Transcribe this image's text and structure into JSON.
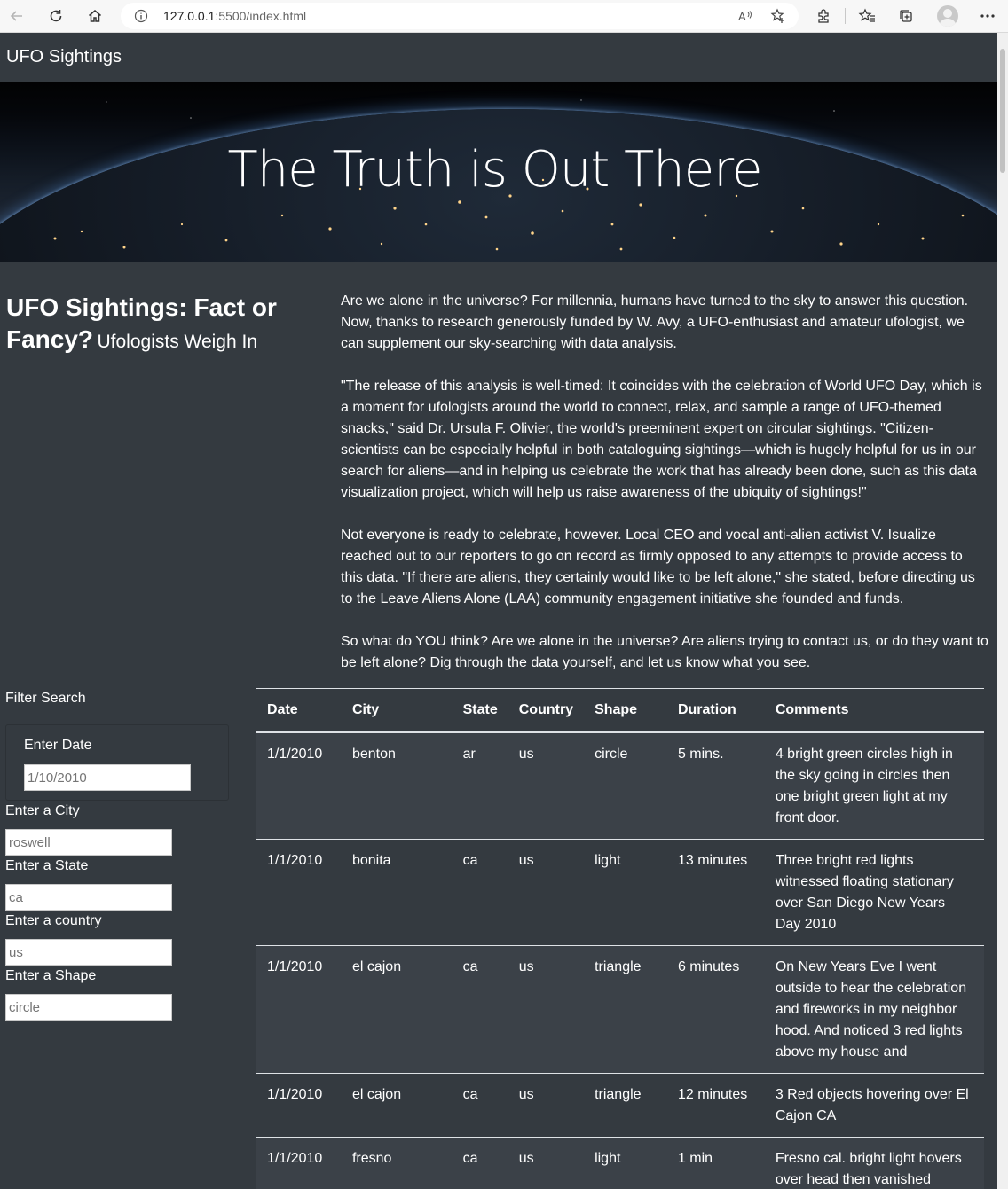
{
  "browser": {
    "url_host": "127.0.0.1",
    "url_rest": ":5500/index.html"
  },
  "navbar": {
    "brand": "UFO Sightings"
  },
  "hero": {
    "heading": "The Truth is Out There"
  },
  "article": {
    "title_main": "UFO Sightings: Fact or Fancy?",
    "title_sub": "Ufologists Weigh In",
    "paragraphs": [
      "Are we alone in the universe? For millennia, humans have turned to the sky to answer this question. Now, thanks to research generously funded by W. Avy, a UFO-enthusiast and amateur ufologist, we can supplement our sky-searching with data analysis.",
      "\"The release of this analysis is well-timed: It coincides with the celebration of World UFO Day, which is a moment for ufologists around the world to connect, relax, and sample a range of UFO-themed snacks,\" said Dr. Ursula F. Olivier, the world's preeminent expert on circular sightings. \"Citizen-scientists can be especially helpful in both cataloguing sightings—which is hugely helpful for us in our search for aliens—and in helping us celebrate the work that has already been done, such as this data visualization project, which will help us raise awareness of the ubiquity of sightings!\"",
      "Not everyone is ready to celebrate, however. Local CEO and vocal anti-alien activist V. Isualize reached out to our reporters to go on record as firmly opposed to any attempts to provide access to this data. \"If there are aliens, they certainly would like to be left alone,\" she stated, before directing us to the Leave Aliens Alone (LAA) community engagement initiative she founded and funds.",
      "So what do YOU think? Are we alone in the universe? Are aliens trying to contact us, or do they want to be left alone? Dig through the data yourself, and let us know what you see."
    ]
  },
  "filters": {
    "title": "Filter Search",
    "date_label": "Enter Date",
    "date_placeholder": "1/10/2010",
    "city_label": "Enter a City",
    "city_placeholder": "roswell",
    "state_label": "Enter a State",
    "state_placeholder": "ca",
    "country_label": "Enter a country",
    "country_placeholder": "us",
    "shape_label": "Enter a Shape",
    "shape_placeholder": "circle"
  },
  "table": {
    "headers": [
      "Date",
      "City",
      "State",
      "Country",
      "Shape",
      "Duration",
      "Comments"
    ],
    "rows": [
      [
        "1/1/2010",
        "benton",
        "ar",
        "us",
        "circle",
        "5 mins.",
        "4 bright green circles high in the sky going in circles then one bright green light at my front door."
      ],
      [
        "1/1/2010",
        "bonita",
        "ca",
        "us",
        "light",
        "13 minutes",
        "Three bright red lights witnessed floating stationary over San Diego New Years Day 2010"
      ],
      [
        "1/1/2010",
        "el cajon",
        "ca",
        "us",
        "triangle",
        "6 minutes",
        "On New Years Eve I went outside to hear the celebration and fireworks in my neighbor hood. And noticed 3 red lights above my house and"
      ],
      [
        "1/1/2010",
        "el cajon",
        "ca",
        "us",
        "triangle",
        "12 minutes",
        "3 Red objects hovering over El Cajon CA"
      ],
      [
        "1/1/2010",
        "fresno",
        "ca",
        "us",
        "light",
        "1 min",
        "Fresno cal. bright light hovers over head then vanished"
      ]
    ]
  }
}
